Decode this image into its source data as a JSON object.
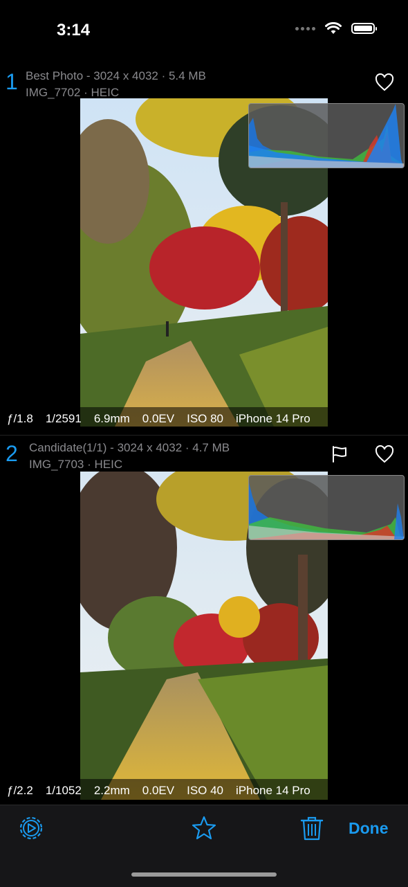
{
  "status_bar": {
    "time": "3:14"
  },
  "photos": [
    {
      "index": "1",
      "title": "Best Photo - 3024 x 4032 · 5.4 MB",
      "file": "IMG_7702 · HEIC",
      "exif": {
        "aperture": "ƒ/1.8",
        "shutter": "1/2591",
        "focal": "6.9mm",
        "ev": "0.0EV",
        "iso": "ISO 80",
        "camera": "iPhone 14 Pro"
      }
    },
    {
      "index": "2",
      "title": "Candidate(1/1) - 3024 x 4032 · 4.7 MB",
      "file": "IMG_7703 · HEIC",
      "exif": {
        "aperture": "ƒ/2.2",
        "shutter": "1/1052",
        "focal": "2.2mm",
        "ev": "0.0EV",
        "iso": "ISO 40",
        "camera": "iPhone 14 Pro"
      }
    }
  ],
  "toolbar": {
    "done_label": "Done"
  },
  "colors": {
    "accent": "#1a9bf0",
    "secondary_text": "#8a8a8e",
    "background": "#000000"
  },
  "icons": [
    "settings-icon",
    "star-icon",
    "trash-icon",
    "heart-icon",
    "flag-icon"
  ]
}
